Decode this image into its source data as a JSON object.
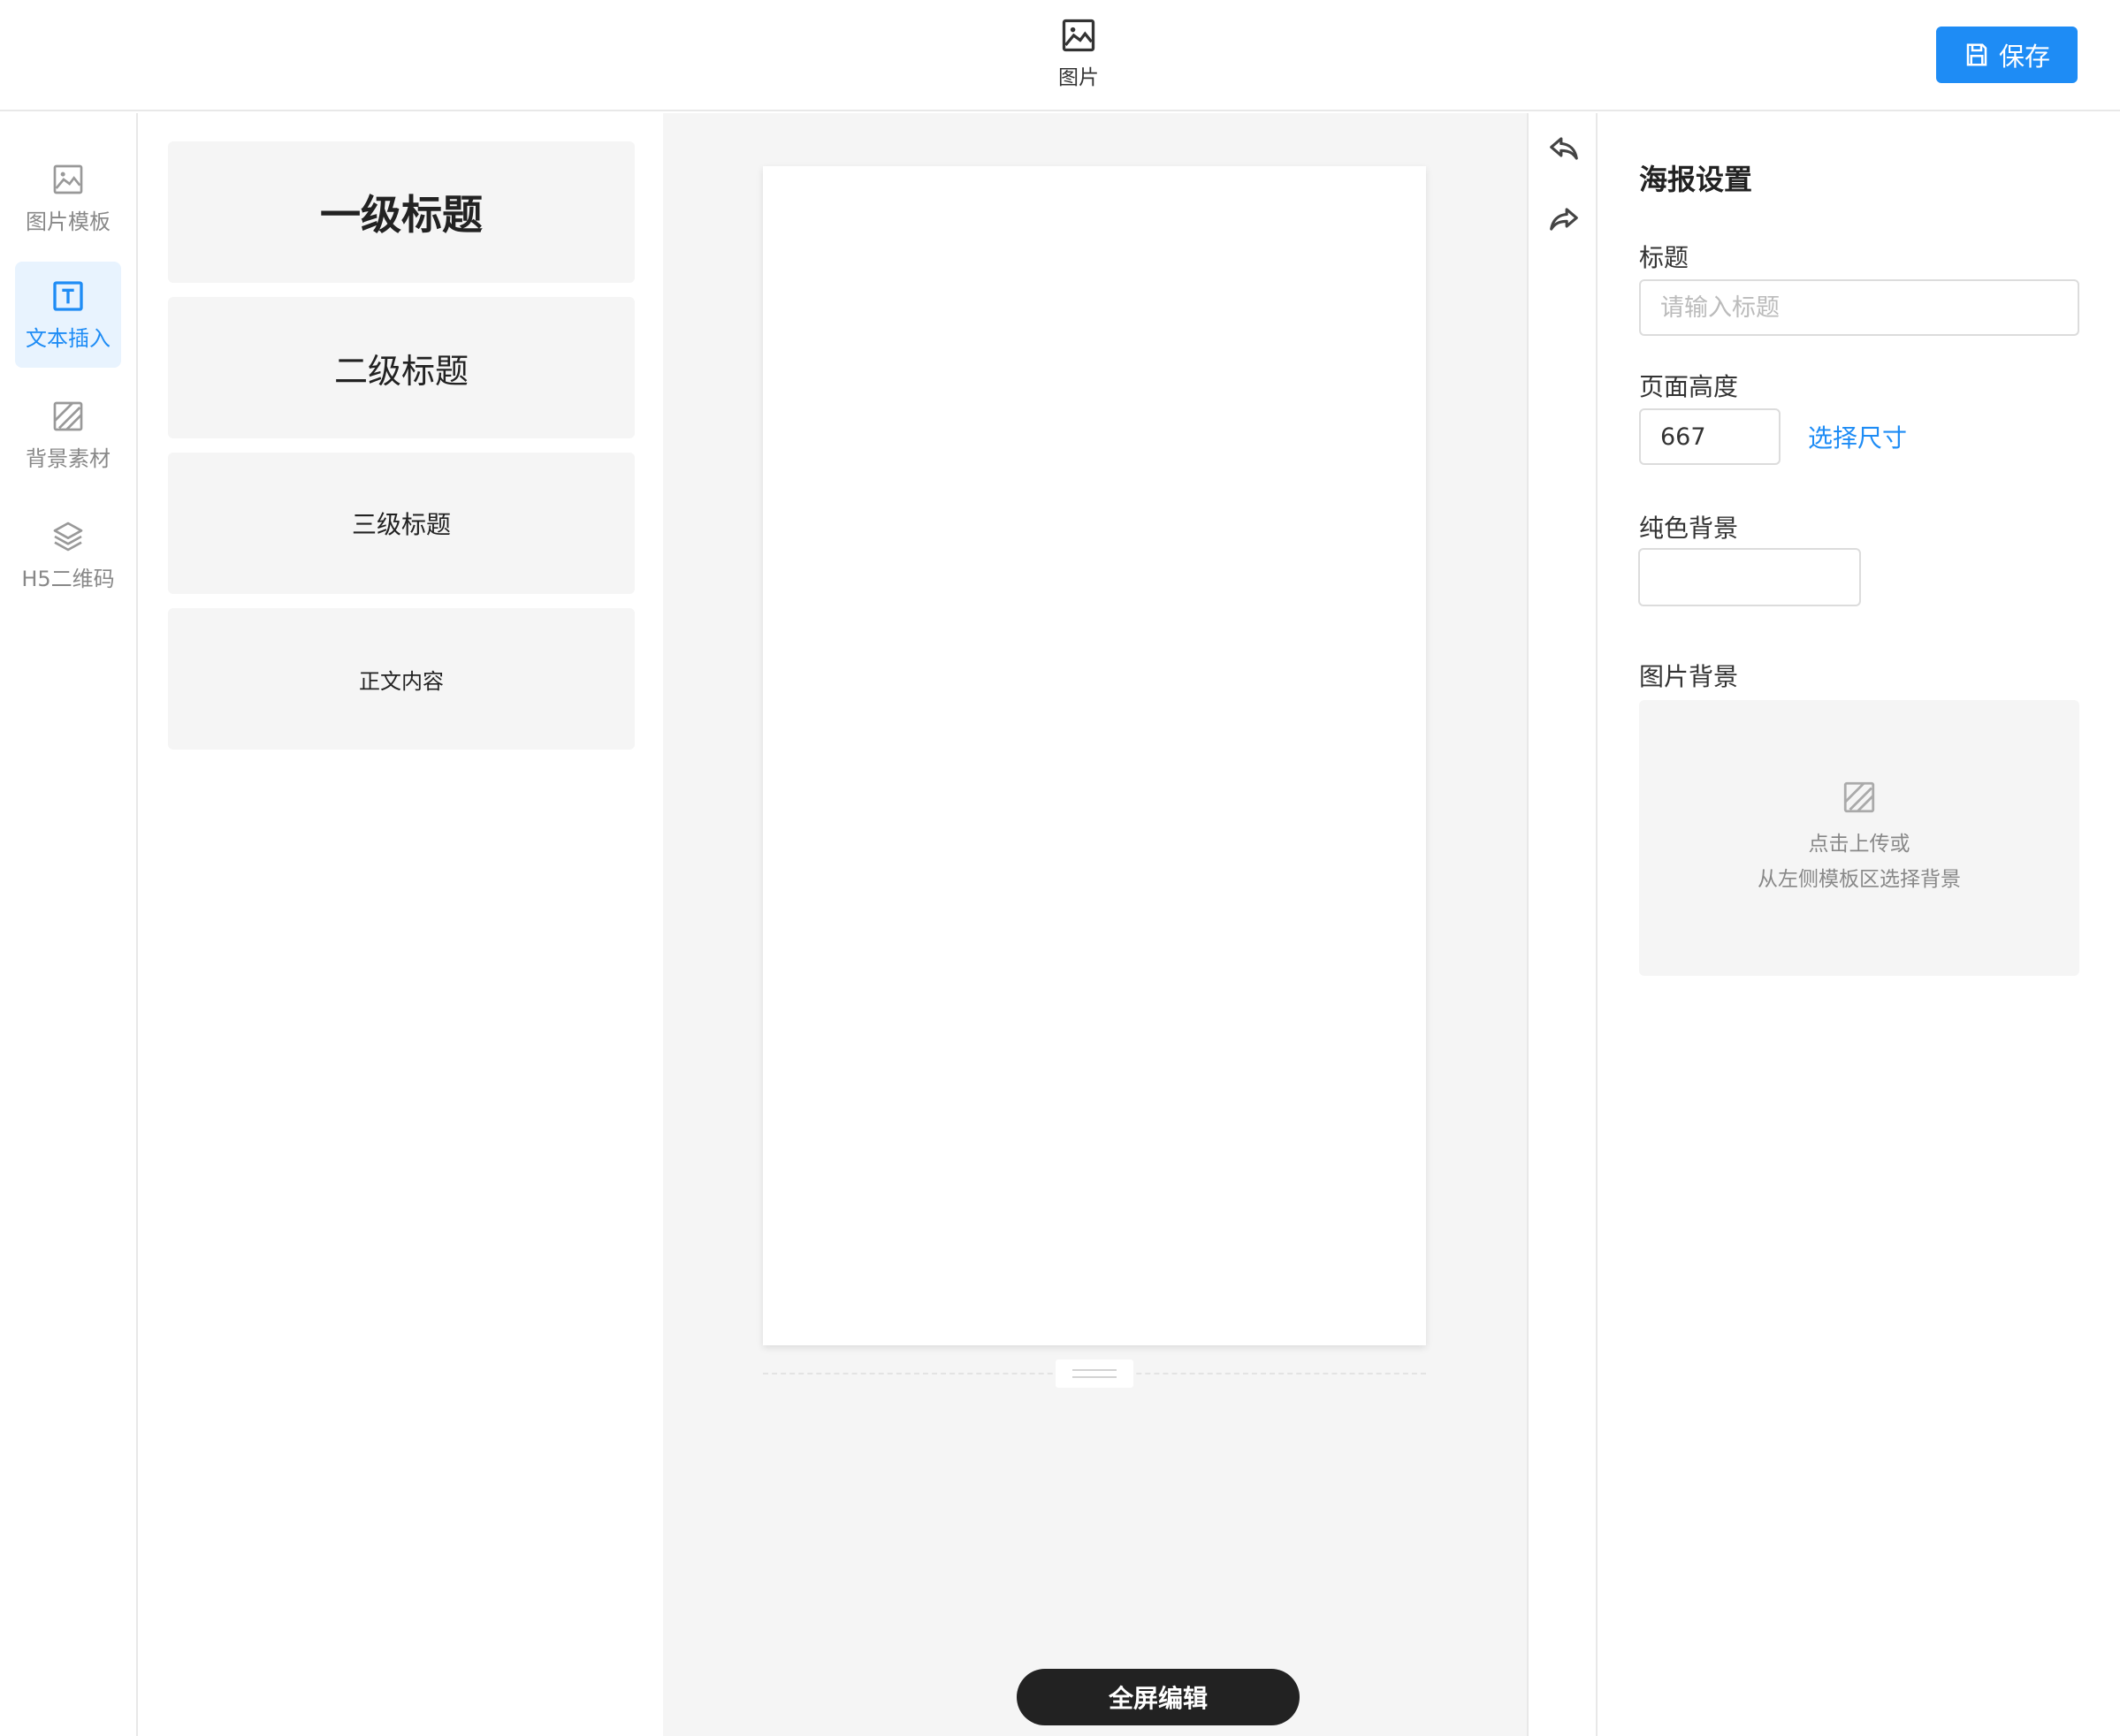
{
  "header": {
    "tab_label": "图片",
    "tab_icon": "image-icon",
    "save_label": "保存",
    "save_icon": "floppy-disk-icon"
  },
  "leftnav": {
    "items": [
      {
        "label": "图片模板",
        "icon": "image-icon",
        "active": false
      },
      {
        "label": "文本插入",
        "icon": "text-box-icon",
        "active": true
      },
      {
        "label": "背景素材",
        "icon": "hatched-square-icon",
        "active": false
      },
      {
        "label": "H5二维码",
        "icon": "layers-icon",
        "active": false
      }
    ]
  },
  "text_templates": [
    {
      "label": "一级标题"
    },
    {
      "label": "二级标题"
    },
    {
      "label": "三级标题"
    },
    {
      "label": "正文内容"
    }
  ],
  "canvas": {
    "fullscreen_label": "全屏编辑"
  },
  "history": {
    "undo_icon": "undo-icon",
    "redo_icon": "redo-icon"
  },
  "settings": {
    "title": "海报设置",
    "title_field": {
      "label": "标题",
      "placeholder": "请输入标题",
      "value": ""
    },
    "height_field": {
      "label": "页面高度",
      "value": "667",
      "link_label": "选择尺寸"
    },
    "solid_bg": {
      "label": "纯色背景",
      "color": "#ffffff"
    },
    "image_bg": {
      "label": "图片背景",
      "upload_line1": "点击上传或",
      "upload_line2": "从左侧模板区选择背景"
    }
  },
  "colors": {
    "accent": "#1e8cf5",
    "active_nav_bg": "#e8f3fe",
    "canvas_bg": "#f5f5f5",
    "dark_button": "#222222"
  }
}
